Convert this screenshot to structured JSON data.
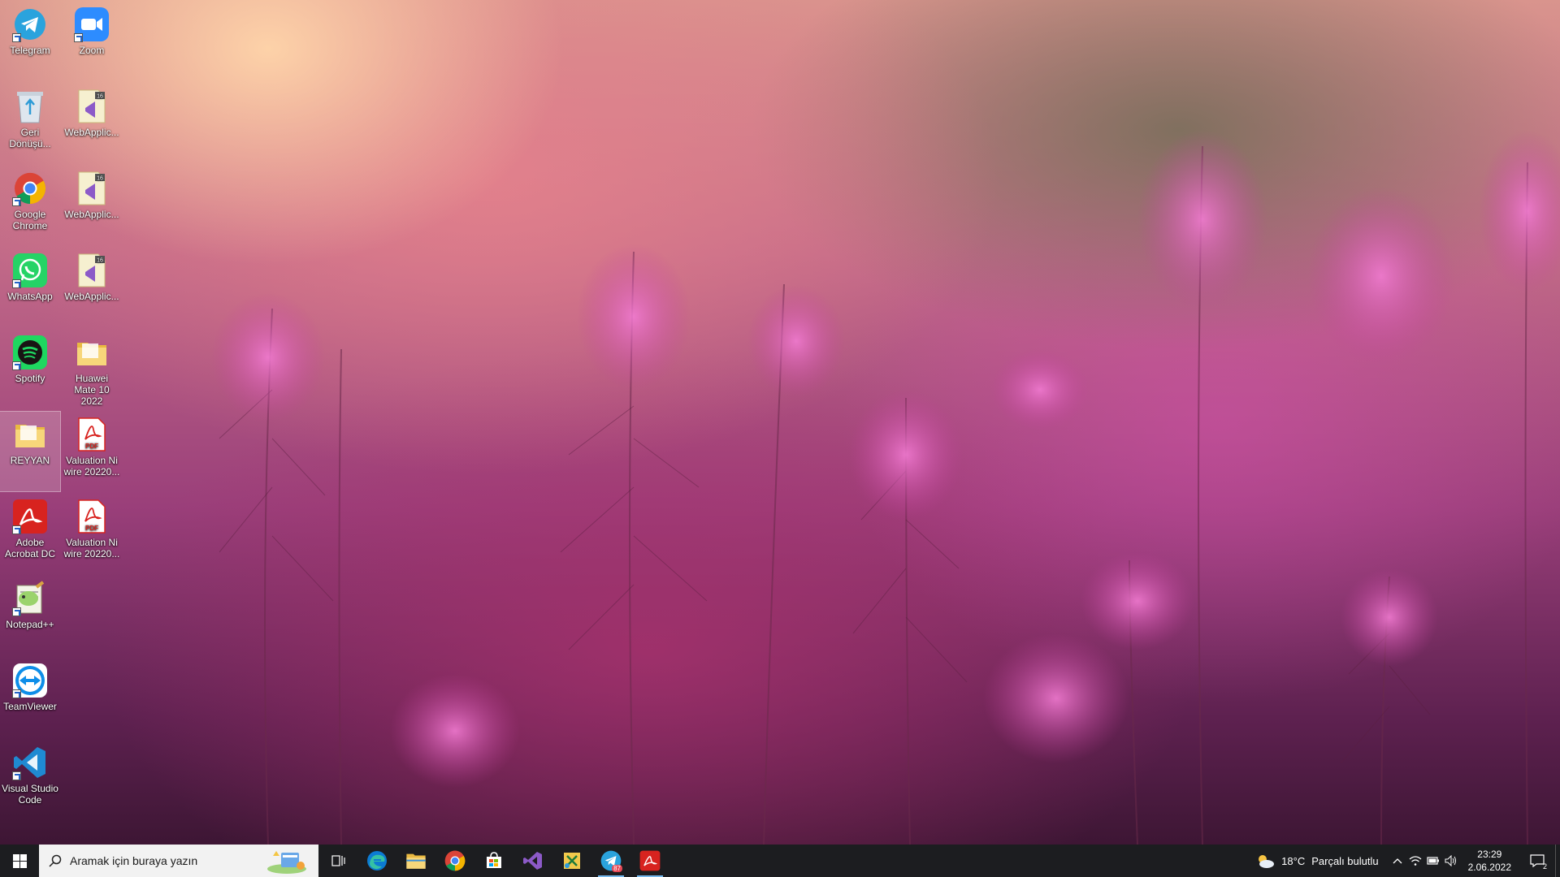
{
  "desktop": {
    "icons": [
      {
        "label": "Telegram",
        "icon": "telegram-icon"
      },
      {
        "label": "Zoom",
        "icon": "zoom-icon"
      },
      {
        "label": "Geri Dönüşü...",
        "icon": "recycle-bin-icon"
      },
      {
        "label": "WebApplic...",
        "icon": "visual-studio-solution-icon"
      },
      {
        "label": "Google Chrome",
        "icon": "chrome-icon"
      },
      {
        "label": "WebApplic...",
        "icon": "visual-studio-solution-icon"
      },
      {
        "label": "WhatsApp",
        "icon": "whatsapp-icon"
      },
      {
        "label": "WebApplic...",
        "icon": "visual-studio-solution-icon"
      },
      {
        "label": "Spotify",
        "icon": "spotify-icon"
      },
      {
        "label": "Huawei Mate 10 2022",
        "icon": "folder-icon"
      },
      {
        "label": "REYYAN",
        "icon": "folder-icon"
      },
      {
        "label": "Valuation Ni wire 20220...",
        "icon": "pdf-icon"
      },
      {
        "label": "Adobe Acrobat DC",
        "icon": "acrobat-icon"
      },
      {
        "label": "Valuation Ni wire 20220...",
        "icon": "pdf-icon"
      },
      {
        "label": "Notepad++",
        "icon": "notepadpp-icon"
      },
      {
        "label": "TeamViewer",
        "icon": "teamviewer-icon"
      },
      {
        "label": "Visual Studio Code",
        "icon": "vscode-icon"
      }
    ],
    "pdf_badge": "PDF",
    "vs_badge": "16"
  },
  "taskbar": {
    "search_placeholder": "Aramak için buraya yazın",
    "apps": [
      {
        "name": "task-view",
        "icon": "task-view-icon"
      },
      {
        "name": "edge",
        "icon": "edge-icon"
      },
      {
        "name": "file-explorer",
        "icon": "folder-icon"
      },
      {
        "name": "chrome",
        "icon": "chrome-icon"
      },
      {
        "name": "store",
        "icon": "store-icon"
      },
      {
        "name": "visual-studio",
        "icon": "visual-studio-icon"
      },
      {
        "name": "snip",
        "icon": "snip-icon"
      },
      {
        "name": "telegram",
        "icon": "telegram-icon",
        "badge": "87"
      },
      {
        "name": "acrobat",
        "icon": "acrobat-icon"
      }
    ],
    "weather": {
      "temp": "18°C",
      "condition": "Parçalı bulutlu"
    },
    "clock": {
      "time": "23:29",
      "date": "2.06.2022"
    },
    "notifications": "2"
  },
  "colors": {
    "taskbar": "#1c1d20",
    "accent": "#76b9ed",
    "telegram": "#2aa3dd",
    "zoom": "#2d8cff",
    "whatsapp": "#25d366",
    "spotify": "#1ed760",
    "acrobat": "#d8231f",
    "vs": "#8c5ac8",
    "vscode": "#1f8ad2"
  }
}
